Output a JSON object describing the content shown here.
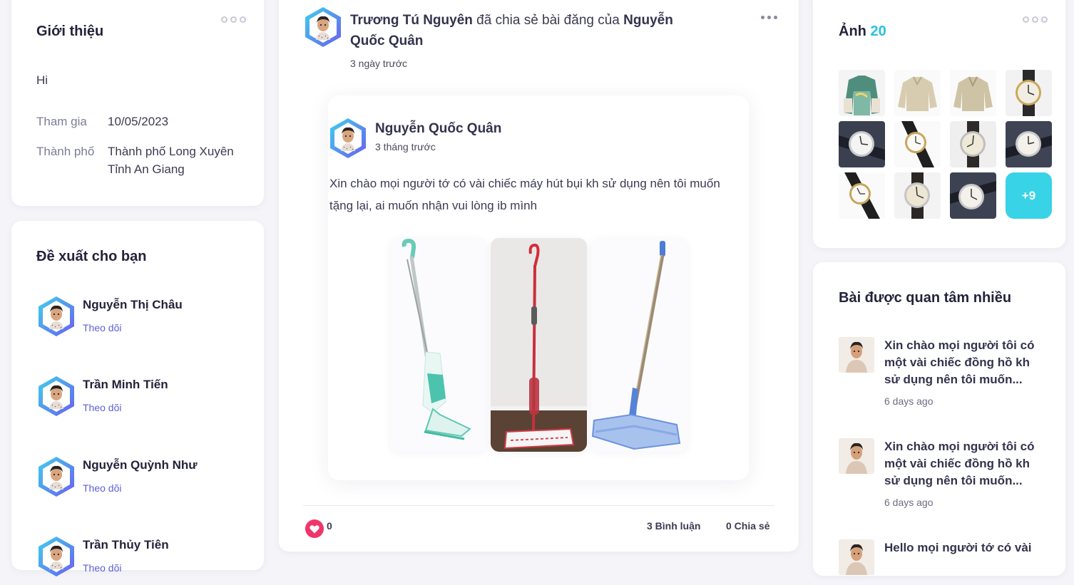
{
  "intro": {
    "title": "Giới thiệu",
    "bio": "Hi",
    "joined_label": "Tham gia",
    "joined_value": "10/05/2023",
    "city_label": "Thành phố",
    "city_value_line1": "Thành phố Long Xuyên",
    "city_value_line2": "Tỉnh An Giang"
  },
  "suggestions": {
    "title": "Đề xuất cho bạn",
    "items": [
      {
        "name": "Nguyễn Thị Châu",
        "action": "Theo dõi"
      },
      {
        "name": "Trần Minh Tiến",
        "action": "Theo dõi"
      },
      {
        "name": "Nguyễn Quỳnh Như",
        "action": "Theo dõi"
      },
      {
        "name": "Trần Thủy Tiên",
        "action": "Theo dõi"
      }
    ]
  },
  "post": {
    "sharer": "Trương Tú Nguyên",
    "shared_text": " đã chia sẻ bài đăng của ",
    "original_author": "Nguyễn Quốc Quân",
    "time": "3 ngày trước",
    "inner": {
      "author": "Nguyễn Quốc Quân",
      "time": "3 tháng trước",
      "text": "Xin chào mọi người tớ có vài chiếc máy hút bụi kh sử dụng nên tôi muốn tặng lại, ai muốn nhận vui lòng ib mình"
    },
    "likes": "0",
    "comments": "3 Bình luận",
    "shares": "0 Chia sẻ"
  },
  "photos": {
    "title": "Ảnh",
    "count": "20",
    "more": "+9"
  },
  "popular": {
    "title": "Bài được quan tâm nhiều",
    "items": [
      {
        "title": "Xin chào mọi người tôi có một vài chiếc đồng hồ kh sử dụng nên tôi muốn...",
        "date": "6 days ago"
      },
      {
        "title": "Xin chào mọi người tôi có một vài chiếc đồng hồ kh sử dụng nên tôi muốn...",
        "date": "6 days ago"
      },
      {
        "title": "Hello mọi người tớ có vài",
        "date": ""
      }
    ]
  },
  "colors": {
    "accent": "#5d5fd4",
    "cyan": "#38d3e6",
    "heart": "#f0356b"
  }
}
